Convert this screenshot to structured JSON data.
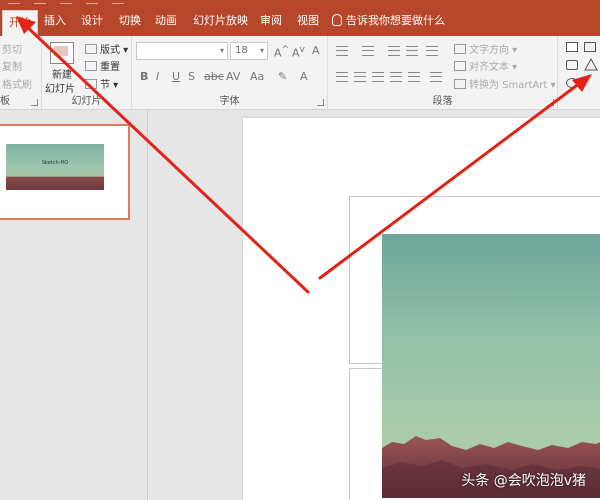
{
  "tabs": [
    "开始",
    "插入",
    "设计",
    "切换",
    "动画",
    "幻灯片放映",
    "审阅",
    "视图"
  ],
  "tell_me": "告诉我你想要做什么",
  "clipboard": {
    "cut": "剪切",
    "copy": "复制",
    "format_painter": "格式刷",
    "label": "板"
  },
  "slides_group": {
    "new_slide_line1": "新建",
    "new_slide_line2": "幻灯片",
    "layout": "版式",
    "reset": "重置",
    "section": "节",
    "label": "幻灯片"
  },
  "font_group": {
    "size": "18",
    "label": "字体",
    "bold": "B",
    "italic": "I",
    "underline": "U",
    "shadow": "S",
    "strike": "abc",
    "spacing": "AV",
    "case": "Aa",
    "color": "A"
  },
  "paragraph_group": {
    "text_direction": "文字方向",
    "align_text": "对齐文本",
    "smartart": "转换为 SmartArt",
    "label": "段落"
  },
  "thumbnail": {
    "number": "1",
    "text": "Sketch-HO"
  },
  "watermark": "头条 @会吹泡泡v猪",
  "colors": {
    "accent": "#b7472a",
    "arrow": "#e32219"
  }
}
